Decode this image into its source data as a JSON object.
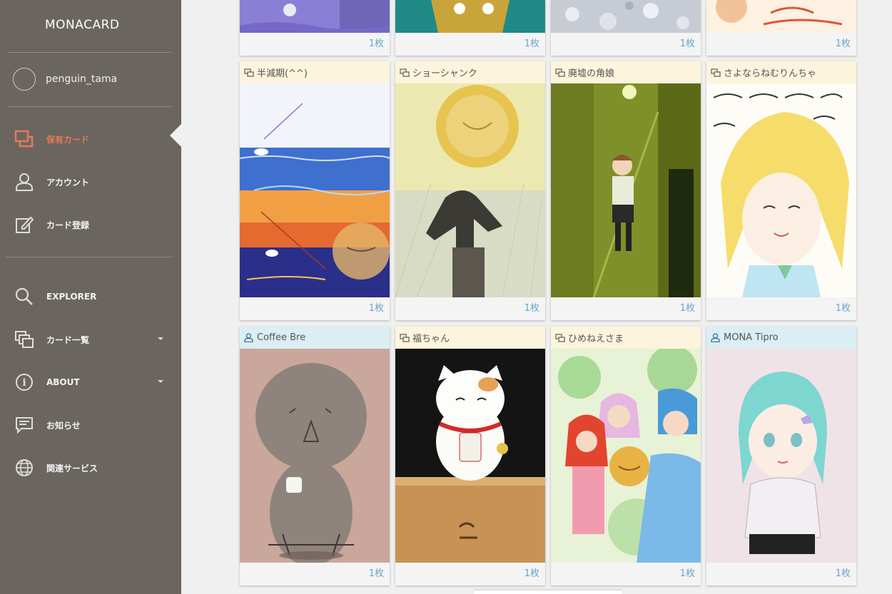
{
  "sidebar": {
    "brand": "MONACARD",
    "username": "penguin_tama",
    "nav": [
      {
        "label": "保有カード",
        "icon": "owned-cards-icon",
        "active": true
      },
      {
        "label": "アカウント",
        "icon": "account-icon"
      },
      {
        "label": "カード登録",
        "icon": "card-register-icon"
      }
    ],
    "nav2": [
      {
        "label": "EXPLORER",
        "icon": "search-icon"
      },
      {
        "label": "カード一覧",
        "icon": "card-list-icon",
        "dropdown": true
      },
      {
        "label": "ABOUT",
        "icon": "info-icon",
        "dropdown": true
      },
      {
        "label": "お知らせ",
        "icon": "news-icon"
      },
      {
        "label": "関連サービス",
        "icon": "globe-icon"
      }
    ],
    "accent_color": "#e57a54"
  },
  "top_row": [
    {
      "count": "1枚"
    },
    {
      "count": "1枚"
    },
    {
      "count": "1枚"
    },
    {
      "count": "1枚"
    }
  ],
  "cards": [
    {
      "title": "半減期(^^)",
      "type": "group",
      "count": "1枚"
    },
    {
      "title": "ショーシャンク",
      "type": "group",
      "count": "1枚"
    },
    {
      "title": "廃墟の角娘",
      "type": "group",
      "count": "1枚"
    },
    {
      "title": "さよならねむりんちゃ",
      "type": "group",
      "count": "1枚"
    },
    {
      "title": "Coffee Bre",
      "type": "user",
      "count": "1枚"
    },
    {
      "title": "福ちゃん",
      "type": "group",
      "count": "1枚"
    },
    {
      "title": "ひめねえさま",
      "type": "group",
      "count": "1枚"
    },
    {
      "title": "MONA Tipro",
      "type": "user",
      "count": "1枚"
    }
  ]
}
